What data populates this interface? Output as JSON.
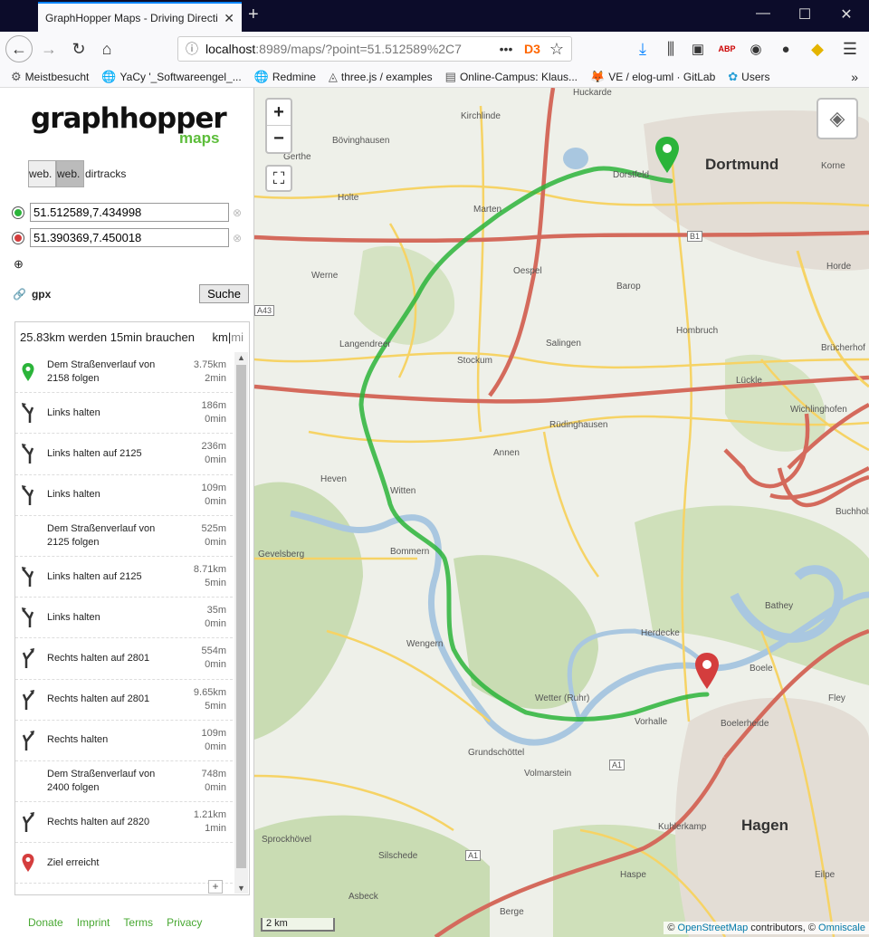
{
  "browser": {
    "tab_title": "GraphHopper Maps - Driving Directions",
    "url_host": "localhost",
    "url_rest": ":8989/maps/?point=51.512589%2C7",
    "bookmarks": [
      "Meistbesucht",
      "YaCy '_Softwareengel_...",
      "Redmine",
      "three.js / examples",
      "Online-Campus: Klaus...",
      "VE / elog-uml · GitLab",
      "Users"
    ]
  },
  "sidebar": {
    "logo": "graphhopper",
    "logo_sub": "maps",
    "vehicle_buttons": [
      "web.",
      "web.",
      "dirtracks"
    ],
    "start_point": "51.512589,7.434998",
    "end_point": "51.390369,7.450018",
    "gpx_label": "gpx",
    "search_label": "Suche",
    "summary": "25.83km werden 15min brauchen",
    "unit_km": "km",
    "unit_mi": "mi",
    "instructions": [
      {
        "icon": "start-marker-icon",
        "text": "Dem Straßenverlauf von 2158 folgen",
        "dist": "3.75km",
        "time": "2min"
      },
      {
        "icon": "keep-left-icon",
        "text": "Links halten",
        "dist": "186m",
        "time": "0min"
      },
      {
        "icon": "keep-left-icon",
        "text": "Links halten auf 2125",
        "dist": "236m",
        "time": "0min"
      },
      {
        "icon": "keep-left-icon",
        "text": "Links halten",
        "dist": "109m",
        "time": "0min"
      },
      {
        "icon": "",
        "text": "Dem Straßenverlauf von 2125 folgen",
        "dist": "525m",
        "time": "0min"
      },
      {
        "icon": "keep-left-icon",
        "text": "Links halten auf 2125",
        "dist": "8.71km",
        "time": "5min"
      },
      {
        "icon": "keep-left-icon",
        "text": "Links halten",
        "dist": "35m",
        "time": "0min"
      },
      {
        "icon": "keep-right-icon",
        "text": "Rechts halten auf 2801",
        "dist": "554m",
        "time": "0min"
      },
      {
        "icon": "keep-right-icon",
        "text": "Rechts halten auf 2801",
        "dist": "9.65km",
        "time": "5min"
      },
      {
        "icon": "keep-right-icon",
        "text": "Rechts halten",
        "dist": "109m",
        "time": "0min"
      },
      {
        "icon": "",
        "text": "Dem Straßenverlauf von 2400 folgen",
        "dist": "748m",
        "time": "0min"
      },
      {
        "icon": "keep-right-icon",
        "text": "Rechts halten auf 2820",
        "dist": "1.21km",
        "time": "1min"
      },
      {
        "icon": "end-marker-icon",
        "text": "Ziel erreicht",
        "dist": "",
        "time": ""
      }
    ],
    "footer": [
      "Donate",
      "Imprint",
      "Terms",
      "Privacy"
    ]
  },
  "map": {
    "scale": "2 km",
    "attribution_prefix": "©",
    "attribution_osm": "OpenStreetMap",
    "attribution_mid": "contributors, ©",
    "attribution_omni": "Omniscale",
    "cities": [
      "Dortmund",
      "Hagen"
    ],
    "places": [
      "Huckarde",
      "Kirchlinde",
      "Bövinghausen",
      "Gerthe",
      "Holte",
      "Marten",
      "Dorstfeld",
      "Korne",
      "Werne",
      "Oespel",
      "Barop",
      "Horde",
      "Langendreer",
      "Stockum",
      "Salingen",
      "Hombruch",
      "Brücherhof",
      "Lückle",
      "Rüdinghausen",
      "Wichlinghofen",
      "Annen",
      "Heven",
      "Witten",
      "Buchholz",
      "Bommern",
      "Bathey",
      "Herdecke",
      "Boele",
      "Wengern",
      "Wetter (Ruhr)",
      "Vorhalle",
      "Fley",
      "Boelerheide",
      "Grundschöttel",
      "Volmarstein",
      "Kuhlerkamp",
      "Silschede",
      "Haspe",
      "Eilpe",
      "Asbeck",
      "Berge",
      "Sprockhövel",
      "Gevelsberg"
    ],
    "road_labels": [
      "B1",
      "A1",
      "A1",
      "A43"
    ]
  }
}
